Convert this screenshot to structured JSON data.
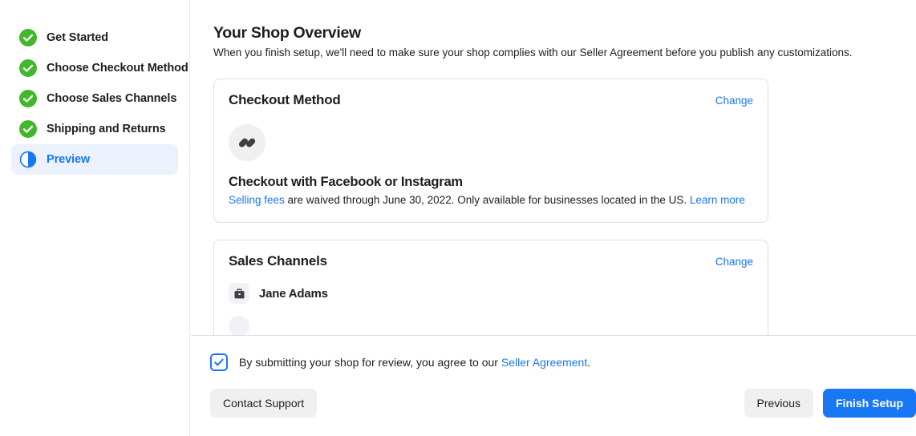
{
  "sidebar": {
    "steps": [
      {
        "label": "Get Started",
        "state": "complete",
        "icon": "check-circle-icon"
      },
      {
        "label": "Choose Checkout Method",
        "state": "complete",
        "icon": "check-circle-icon"
      },
      {
        "label": "Choose Sales Channels",
        "state": "complete",
        "icon": "check-circle-icon"
      },
      {
        "label": "Shipping and Returns",
        "state": "complete",
        "icon": "check-circle-icon"
      },
      {
        "label": "Preview",
        "state": "active",
        "icon": "half-circle-icon"
      }
    ]
  },
  "main": {
    "title": "Your Shop Overview",
    "subtitle": "When you finish setup, we'll need to make sure your shop complies with our Seller Agreement before you publish any customizations.",
    "checkout_card": {
      "title": "Checkout Method",
      "change_label": "Change",
      "icon": "checkout-shop-icon",
      "method_name": "Checkout with Facebook or Instagram",
      "desc_link_start": "Selling fees",
      "desc_middle": " are waived through June 30, 2022. Only available for businesses located in the US. ",
      "desc_link_end": "Learn more"
    },
    "sales_card": {
      "title": "Sales Channels",
      "change_label": "Change",
      "channels": [
        {
          "name": "Jane Adams",
          "icon": "briefcase-icon"
        }
      ]
    }
  },
  "footer": {
    "agreement_prefix": "By submitting your shop for review, you agree to our ",
    "agreement_link": "Seller Agreement",
    "agreement_suffix": ".",
    "checkbox_checked": true,
    "contact_support_label": "Contact Support",
    "previous_label": "Previous",
    "finish_label": "Finish Setup"
  },
  "colors": {
    "accent_blue": "#1877f2",
    "success_green": "#42b72a",
    "text": "#1c1e21",
    "card_border": "#dddfe2",
    "active_bg": "#ebf2fd"
  }
}
